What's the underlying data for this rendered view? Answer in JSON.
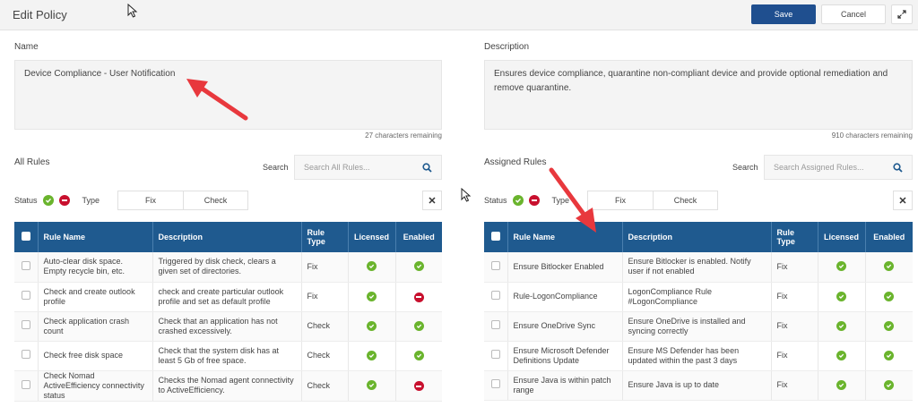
{
  "header": {
    "title": "Edit Policy",
    "save_label": "Save",
    "cancel_label": "Cancel"
  },
  "name": {
    "label": "Name",
    "value": "Device Compliance - User Notification",
    "remaining": "27 characters remaining"
  },
  "description": {
    "label": "Description",
    "value": "Ensures device compliance, quarantine non-compliant device and provide optional remediation and remove quarantine.",
    "remaining": "910 characters remaining"
  },
  "all_rules": {
    "title": "All Rules",
    "search_label": "Search",
    "search_placeholder": "Search All Rules...",
    "status_label": "Status",
    "type_label": "Type",
    "type_options": [
      "Fix",
      "Check"
    ],
    "columns": [
      "Rule Name",
      "Description",
      "Rule Type",
      "Licensed",
      "Enabled"
    ],
    "rows": [
      {
        "name": "Auto-clear disk space. Empty recycle bin, etc.",
        "description": "Triggered by disk check, clears a given set of directories.",
        "type": "Fix",
        "licensed": true,
        "enabled": true
      },
      {
        "name": "Check and create outlook profile",
        "description": "check and create particular outlook profile and set as default profile",
        "type": "Fix",
        "licensed": true,
        "enabled": false
      },
      {
        "name": "Check application crash count",
        "description": "Check that an application has not crashed excessively.",
        "type": "Check",
        "licensed": true,
        "enabled": true
      },
      {
        "name": "Check free disk space",
        "description": "Check that the system disk has at least 5 Gb of free space.",
        "type": "Check",
        "licensed": true,
        "enabled": true
      },
      {
        "name": "Check Nomad ActiveEfficiency connectivity status",
        "description": "Checks the Nomad agent connectivity to ActiveEfficiency.",
        "type": "Check",
        "licensed": true,
        "enabled": false
      }
    ]
  },
  "assigned_rules": {
    "title": "Assigned Rules",
    "search_label": "Search",
    "search_placeholder": "Search Assigned Rules...",
    "status_label": "Status",
    "type_label": "Type",
    "type_options": [
      "Fix",
      "Check"
    ],
    "columns": [
      "Rule Name",
      "Description",
      "Rule Type",
      "Licensed",
      "Enabled"
    ],
    "rows": [
      {
        "name": "Ensure Bitlocker Enabled",
        "description": "Ensure Bitlocker is enabled. Notify user if not enabled",
        "type": "Fix",
        "licensed": true,
        "enabled": true
      },
      {
        "name": "Rule-LogonCompliance",
        "description": "LogonCompliance Rule #LogonCompliance",
        "type": "Fix",
        "licensed": true,
        "enabled": true
      },
      {
        "name": "Ensure OneDrive Sync",
        "description": "Ensure OneDrive is installed and syncing correctly",
        "type": "Fix",
        "licensed": true,
        "enabled": true
      },
      {
        "name": "Ensure Microsoft Defender Definitions Update",
        "description": "Ensure MS Defender has been updated within the past 3 days",
        "type": "Fix",
        "licensed": true,
        "enabled": true
      },
      {
        "name": "Ensure Java is within patch range",
        "description": "Ensure Java is up to date",
        "type": "Fix",
        "licensed": true,
        "enabled": true
      }
    ]
  },
  "colors": {
    "header_blue": "#1f5a8f",
    "save_blue": "#1f4f8f",
    "enabled_green": "#6ab42d",
    "disabled_red": "#c8102e",
    "annotation_arrow": "#e8383d"
  }
}
